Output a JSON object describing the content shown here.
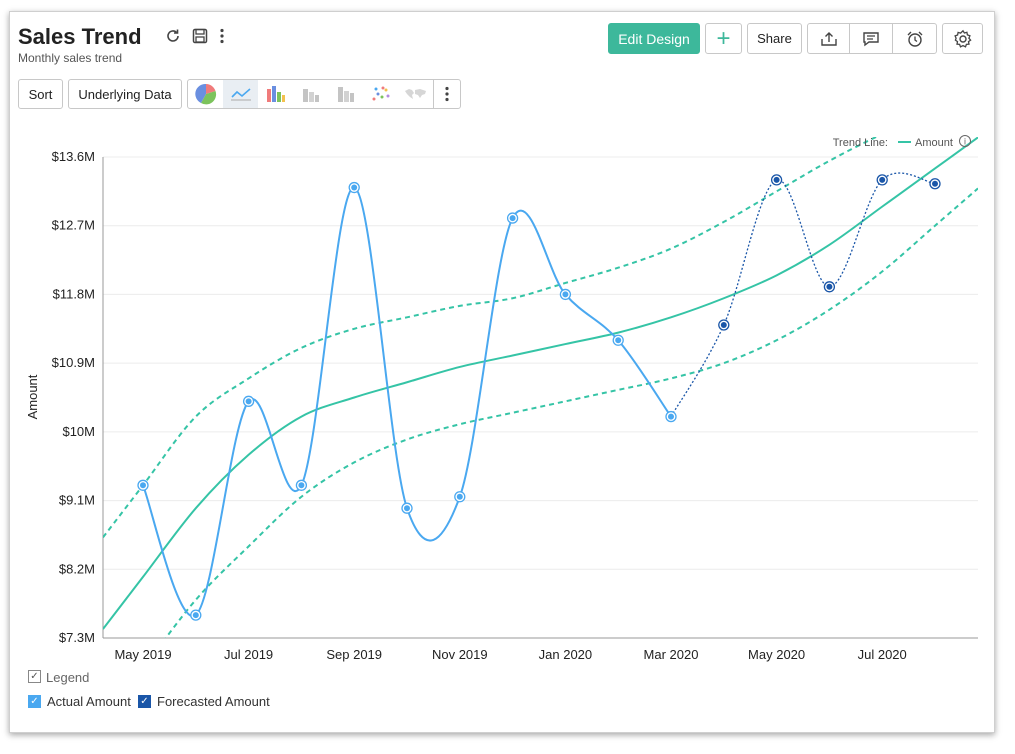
{
  "header": {
    "title": "Sales Trend",
    "subtitle": "Monthly sales trend",
    "edit_design_label": "Edit Design",
    "add_label": "+",
    "share_label": "Share"
  },
  "toolbar": {
    "sort_label": "Sort",
    "underlying_data_label": "Underlying Data",
    "chart_types": [
      "pie-chart-icon",
      "line-chart-icon",
      "bar-chart-icon",
      "stacked-bar-icon",
      "column-chart-icon",
      "scatter-chart-icon",
      "map-chart-icon"
    ]
  },
  "colors": {
    "accent": "#3db89b",
    "actual": "#4aa8f0",
    "forecast": "#1a56a8",
    "trend": "#35c4a6"
  },
  "legend": {
    "title": "Legend",
    "actual_label": "Actual Amount",
    "forecast_label": "Forecasted Amount"
  },
  "chart_data": {
    "type": "line",
    "ylabel": "Amount",
    "y_tick_labels": [
      "$7.3M",
      "$8.2M",
      "$9.1M",
      "$10M",
      "$10.9M",
      "$11.8M",
      "$12.7M",
      "$13.6M"
    ],
    "x_tick_labels": [
      "May 2019",
      "Jul 2019",
      "Sep 2019",
      "Nov 2019",
      "Jan 2020",
      "Mar 2020",
      "May 2020",
      "Jul 2020"
    ],
    "ylim": [
      7.3,
      13.6
    ],
    "trend_label": "Trend Line:",
    "trend_series_label": "Amount",
    "months": [
      "May 2019",
      "Jun 2019",
      "Jul 2019",
      "Aug 2019",
      "Sep 2019",
      "Oct 2019",
      "Nov 2019",
      "Dec 2019",
      "Jan 2020",
      "Feb 2020",
      "Mar 2020",
      "Apr 2020",
      "May 2020",
      "Jun 2020",
      "Jul 2020",
      "Aug 2020"
    ],
    "series": [
      {
        "name": "Actual Amount",
        "values": [
          9.3,
          7.6,
          10.4,
          9.3,
          13.2,
          9.0,
          9.15,
          12.8,
          11.8,
          11.2,
          10.2,
          null,
          null,
          null,
          null,
          null
        ]
      },
      {
        "name": "Forecasted Amount",
        "values": [
          null,
          null,
          null,
          null,
          null,
          null,
          null,
          null,
          null,
          null,
          10.2,
          11.4,
          13.3,
          11.9,
          13.3,
          13.25
        ]
      }
    ],
    "trend": {
      "center": [
        8.1,
        9.0,
        9.7,
        10.2,
        10.45,
        10.65,
        10.85,
        11.0,
        11.15,
        11.3,
        11.5,
        11.75,
        12.05,
        12.45,
        12.95,
        13.45
      ],
      "upper": [
        9.3,
        10.2,
        10.7,
        11.1,
        11.35,
        11.5,
        11.65,
        11.75,
        11.95,
        12.15,
        12.4,
        12.75,
        13.15,
        13.55,
        13.9,
        14.2
      ],
      "lower": [
        6.9,
        7.8,
        8.5,
        9.15,
        9.6,
        9.9,
        10.1,
        10.25,
        10.4,
        10.55,
        10.7,
        10.9,
        11.2,
        11.6,
        12.1,
        12.7
      ]
    }
  }
}
